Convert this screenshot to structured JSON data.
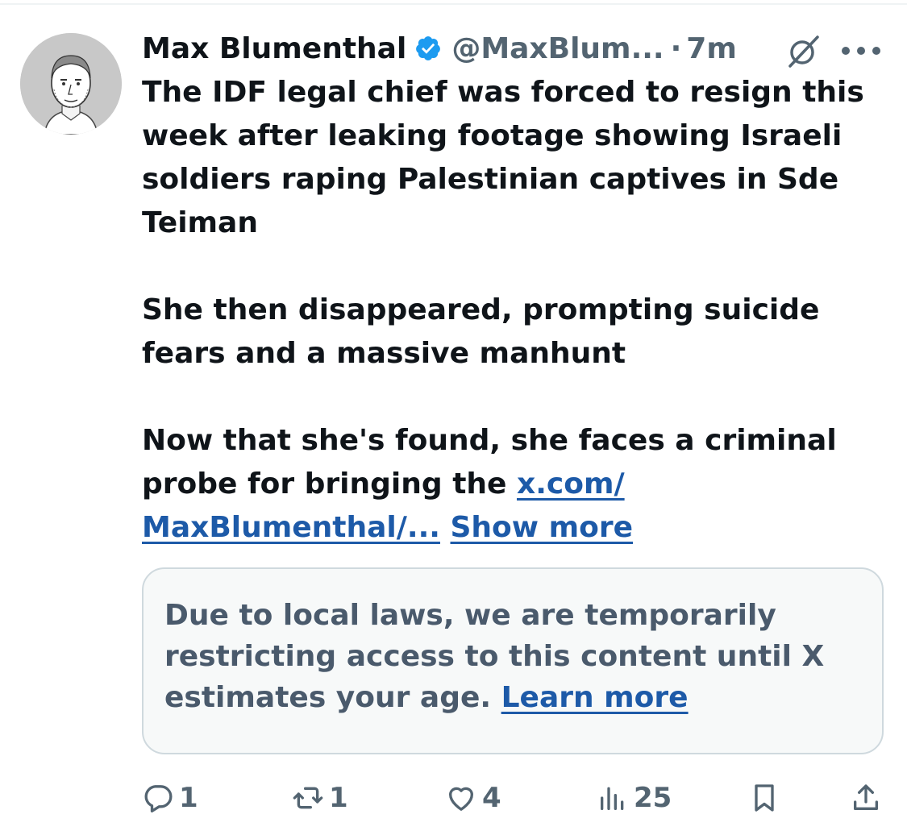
{
  "tweet": {
    "author_name": "Max Blumenthal",
    "handle": "@MaxBlum...",
    "separator": "·",
    "time": "7m",
    "paragraphs": [
      "The IDF legal chief was forced to resign this week after leaking footage showing Israeli soldiers raping Palestinian captives in Sde Teiman",
      "She then disappeared, prompting suicide fears and a massive manhunt"
    ],
    "last_paragraph_text": "Now that she's found, she faces a criminal probe for bringing the ",
    "link_line1": "x.com/",
    "link_line2": "MaxBlumenthal/...",
    "show_more": "Show more"
  },
  "notice": {
    "text": "Due to local laws, we are temporarily restricting access to this content until X estimates your age. ",
    "learn_more": "Learn more"
  },
  "actions": {
    "replies": "1",
    "reposts": "1",
    "likes": "4",
    "views": "25"
  },
  "icons": {
    "verified": "verified-badge-icon",
    "grok": "grok-icon",
    "more": "more-options-icon",
    "reply": "reply-icon",
    "repost": "repost-icon",
    "like": "heart-icon",
    "views": "views-bar-chart-icon",
    "bookmark": "bookmark-icon",
    "share": "share-icon"
  },
  "colors": {
    "link": "#1d5aa8",
    "secondary_text": "#536471",
    "verified": "#1d9bf0",
    "notice_background": "#f7f9f9",
    "notice_border": "#cfd9de"
  }
}
